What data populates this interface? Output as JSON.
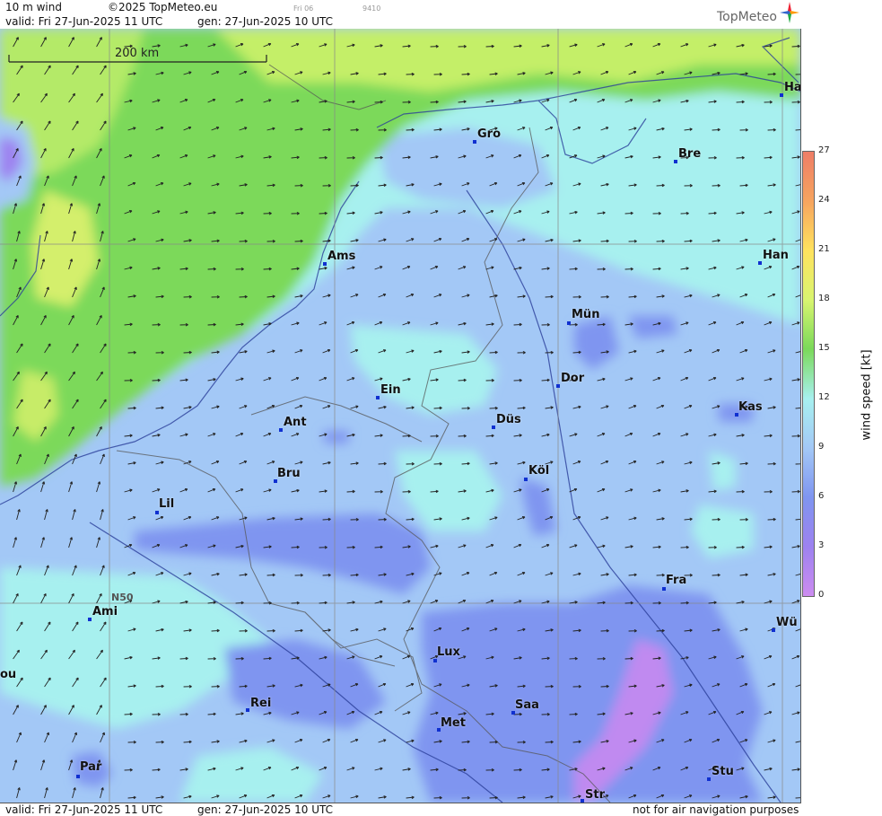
{
  "header": {
    "product": "10 m wind",
    "copyright": "©2025 TopMeteo.eu",
    "small_day": "Fri 06",
    "small_id": "9410",
    "valid": "valid:  Fri  27-Jun-2025  11 UTC",
    "generated": "gen: 27-Jun-2025 10 UTC",
    "logo_text": "TopMeteo"
  },
  "footer": {
    "valid": "valid:  Fri  27-Jun-2025  11 UTC",
    "generated": "gen: 27-Jun-2025 10 UTC",
    "disclaimer": "not for air navigation purposes"
  },
  "map": {
    "scale_label": "200 km",
    "lat_label": "N50",
    "cities": [
      {
        "name": "Ha"
      },
      {
        "name": "Gro"
      },
      {
        "name": "Bre"
      },
      {
        "name": "Ams"
      },
      {
        "name": "Han"
      },
      {
        "name": "Mün"
      },
      {
        "name": "Ein"
      },
      {
        "name": "Dor"
      },
      {
        "name": "Kas"
      },
      {
        "name": "Ant"
      },
      {
        "name": "Düs"
      },
      {
        "name": "Bru"
      },
      {
        "name": "Köl"
      },
      {
        "name": "Lil"
      },
      {
        "name": "Fra"
      },
      {
        "name": "Ami"
      },
      {
        "name": "Wü"
      },
      {
        "name": "ou"
      },
      {
        "name": "Lux"
      },
      {
        "name": "Rei"
      },
      {
        "name": "Saa"
      },
      {
        "name": "Met"
      },
      {
        "name": "Par"
      },
      {
        "name": "Stu"
      },
      {
        "name": "Str"
      }
    ]
  },
  "colorbar": {
    "label": "wind speed [kt]",
    "ticks": [
      "27",
      "24",
      "21",
      "18",
      "15",
      "12",
      "9",
      "6",
      "3",
      "0"
    ],
    "colors": [
      "#ee7d66",
      "#f6a45f",
      "#ffe25e",
      "#d9f570",
      "#7bd95a",
      "#a7f0ef",
      "#a3c8f6",
      "#7f95f0",
      "#9d82f0",
      "#cc8cf0"
    ]
  },
  "wind_field": {
    "direction": "from west-southwest"
  }
}
